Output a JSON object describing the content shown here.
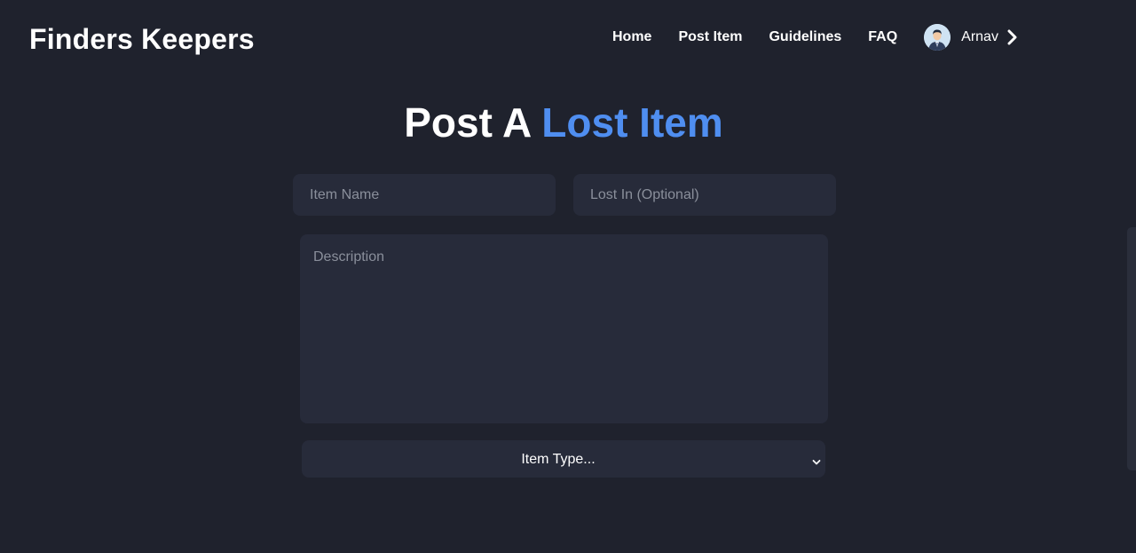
{
  "brand": {
    "name": "Finders Keepers"
  },
  "nav": {
    "items": [
      {
        "label": "Home"
      },
      {
        "label": "Post Item"
      },
      {
        "label": "Guidelines"
      },
      {
        "label": "FAQ"
      }
    ],
    "user": {
      "name": "Arnav",
      "avatar_icon": "user-avatar",
      "chevron_icon": "chevron-right-icon"
    }
  },
  "page": {
    "title_main": "Post A",
    "title_accent": "Lost Item"
  },
  "form": {
    "item_name": {
      "placeholder": "Item Name",
      "value": ""
    },
    "lost_in": {
      "placeholder": "Lost In (Optional)",
      "value": ""
    },
    "description": {
      "placeholder": "Description",
      "value": ""
    },
    "item_type": {
      "selected": "Item Type...",
      "icon": "chevron-down-icon"
    }
  },
  "colors": {
    "background": "#1f222d",
    "field_background": "#272b3a",
    "accent": "#4f8ef0",
    "text": "#ffffff",
    "placeholder": "#8a8f9b"
  }
}
